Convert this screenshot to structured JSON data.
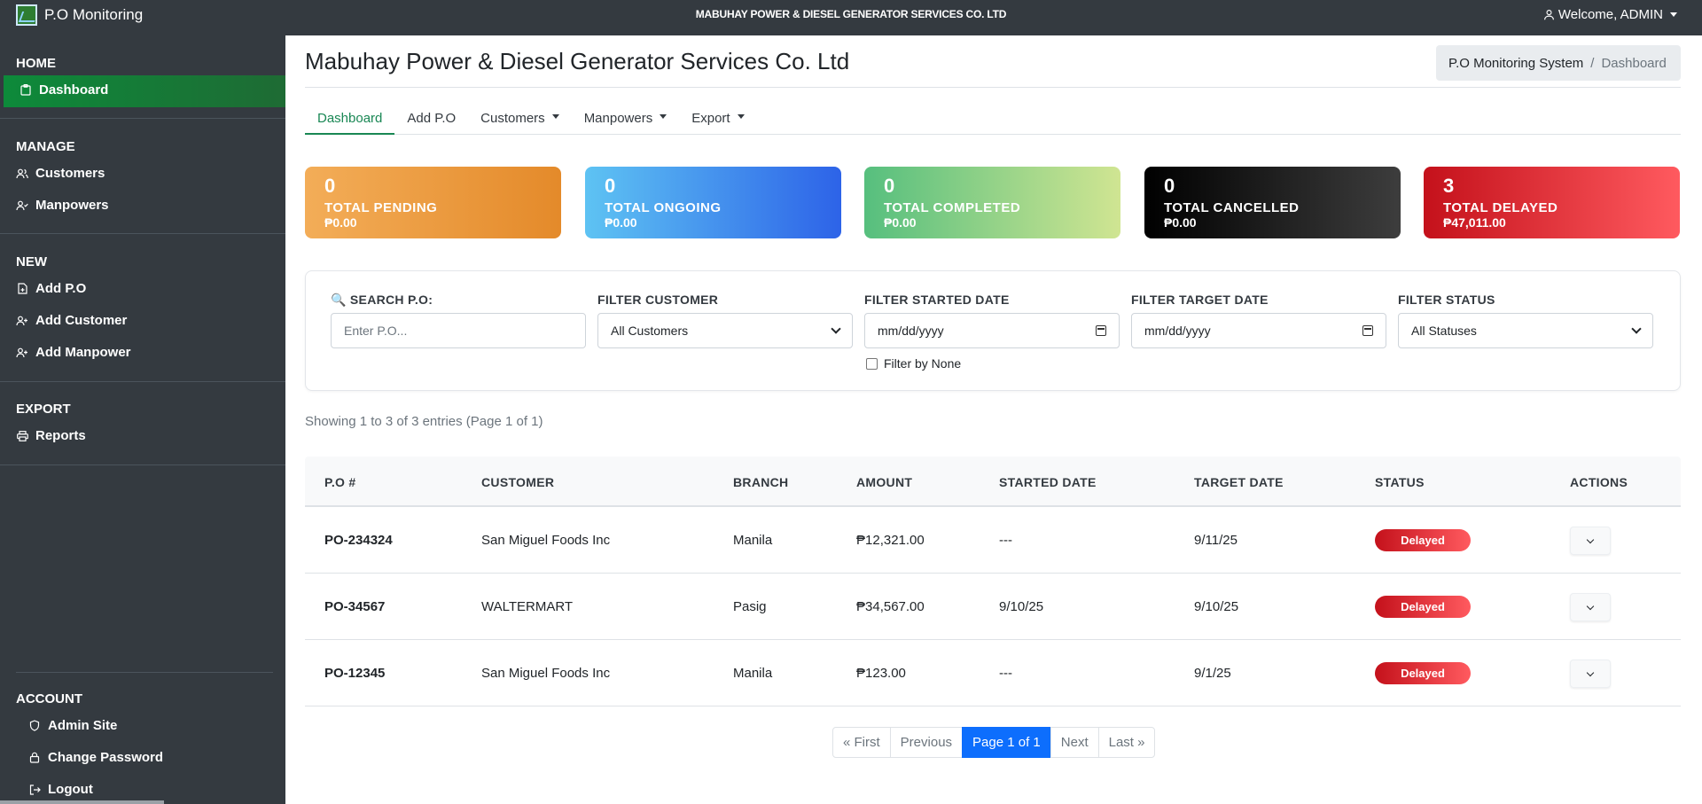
{
  "topbar": {
    "brand": "P.O Monitoring",
    "company": "MABUHAY POWER & DIESEL GENERATOR SERVICES CO. LTD",
    "welcome": "Welcome, ADMIN"
  },
  "sidebar": {
    "sections": {
      "home": "HOME",
      "manage": "MANAGE",
      "new": "NEW",
      "export": "EXPORT",
      "account": "ACCOUNT"
    },
    "items": {
      "dashboard": "Dashboard",
      "customers": "Customers",
      "manpowers": "Manpowers",
      "add_po": "Add P.O",
      "add_customer": "Add Customer",
      "add_manpower": "Add Manpower",
      "reports": "Reports",
      "admin_site": "Admin Site",
      "change_password": "Change Password",
      "logout": "Logout"
    }
  },
  "page": {
    "title": "Mabuhay Power & Diesel Generator Services Co. Ltd",
    "breadcrumb": {
      "root": "P.O Monitoring System",
      "current": "Dashboard"
    }
  },
  "tabs": [
    {
      "label": "Dashboard"
    },
    {
      "label": "Add P.O"
    },
    {
      "label": "Customers"
    },
    {
      "label": "Manpowers"
    },
    {
      "label": "Export"
    }
  ],
  "stats": [
    {
      "count": "0",
      "label": "TOTAL PENDING",
      "amount": "₱0.00",
      "color": "#e48a2a"
    },
    {
      "count": "0",
      "label": "TOTAL ONGOING",
      "amount": "₱0.00",
      "color": "#2d63e8"
    },
    {
      "count": "0",
      "label": "TOTAL COMPLETED",
      "amount": "₱0.00",
      "color": "#56bf7e"
    },
    {
      "count": "0",
      "label": "TOTAL CANCELLED",
      "amount": "₱0.00",
      "color": "#000000"
    },
    {
      "count": "3",
      "label": "TOTAL DELAYED",
      "amount": "₱47,011.00",
      "color": "#c4111b"
    }
  ],
  "filters": {
    "search_label": "🔍 SEARCH P.O:",
    "search_placeholder": "Enter P.O...",
    "customer_label": "FILTER CUSTOMER",
    "customer_value": "All Customers",
    "started_label": "FILTER STARTED DATE",
    "started_placeholder": "mm/dd/yyyy",
    "target_label": "FILTER TARGET DATE",
    "target_placeholder": "mm/dd/yyyy",
    "status_label": "FILTER STATUS",
    "status_value": "All Statuses",
    "filter_none_label": "Filter by None"
  },
  "showing": "Showing 1 to 3 of 3 entries (Page 1 of 1)",
  "table": {
    "headers": [
      "P.O #",
      "CUSTOMER",
      "BRANCH",
      "AMOUNT",
      "STARTED DATE",
      "TARGET DATE",
      "STATUS",
      "ACTIONS"
    ],
    "rows": [
      {
        "po": "PO-234324",
        "customer": "San Miguel Foods Inc",
        "branch": "Manila",
        "amount": "₱12,321.00",
        "started": "---",
        "target": "9/11/25",
        "status": "Delayed"
      },
      {
        "po": "PO-34567",
        "customer": "WALTERMART",
        "branch": "Pasig",
        "amount": "₱34,567.00",
        "started": "9/10/25",
        "target": "9/10/25",
        "status": "Delayed"
      },
      {
        "po": "PO-12345",
        "customer": "San Miguel Foods Inc",
        "branch": "Manila",
        "amount": "₱123.00",
        "started": "---",
        "target": "9/1/25",
        "status": "Delayed"
      }
    ]
  },
  "pagination": {
    "first": "« First",
    "previous": "Previous",
    "current": "Page 1 of 1",
    "next": "Next",
    "last": "Last »"
  },
  "colors": {
    "sidebar_bg": "#343a40",
    "active_green": "#198754",
    "delayed_red": "#c4111b",
    "page_active_blue": "#0d6efd"
  }
}
